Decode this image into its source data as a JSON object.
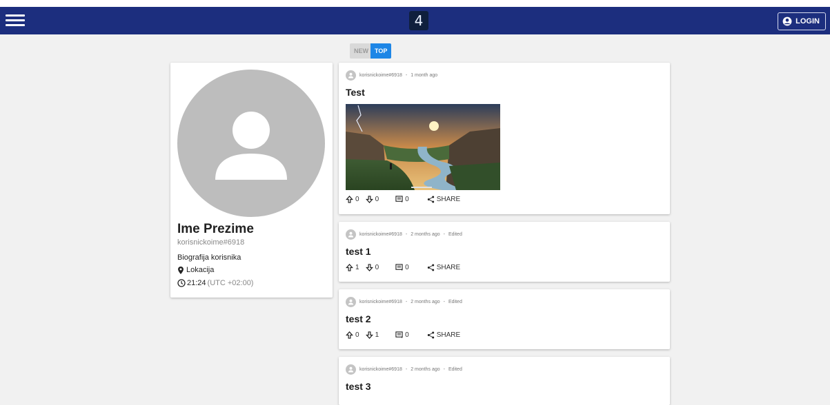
{
  "header": {
    "logo": "4",
    "login_label": "LOGIN",
    "bg_color": "#1c2e7e"
  },
  "sort": {
    "new_label": "NEW",
    "top_label": "TOP",
    "active": "TOP"
  },
  "profile": {
    "name": "Ime Prezime",
    "handle": "korisnickoime#6918",
    "bio": "Biografija korisnika",
    "location": "Lokacija",
    "time": "21:24",
    "timezone": "(UTC +02:00)"
  },
  "posts": [
    {
      "author": "korisnickoime#6918",
      "sep1": "-",
      "age": "1 month ago",
      "edited": "",
      "title": "Test",
      "upvotes": "0",
      "downvotes": "0",
      "comments": "0",
      "share": "SHARE",
      "has_image": true
    },
    {
      "author": "korisnickoime#6918",
      "sep1": "-",
      "age": "2 months ago",
      "sep2": "-",
      "edited": "Edited",
      "title": "test 1",
      "upvotes": "1",
      "downvotes": "0",
      "comments": "0",
      "share": "SHARE"
    },
    {
      "author": "korisnickoime#6918",
      "sep1": "-",
      "age": "2 months ago",
      "sep2": "-",
      "edited": "Edited",
      "title": "test 2",
      "upvotes": "0",
      "downvotes": "1",
      "comments": "0",
      "share": "SHARE"
    },
    {
      "author": "korisnickoime#6918",
      "sep1": "-",
      "age": "2 months ago",
      "sep2": "-",
      "edited": "Edited",
      "title": "test 3"
    }
  ]
}
